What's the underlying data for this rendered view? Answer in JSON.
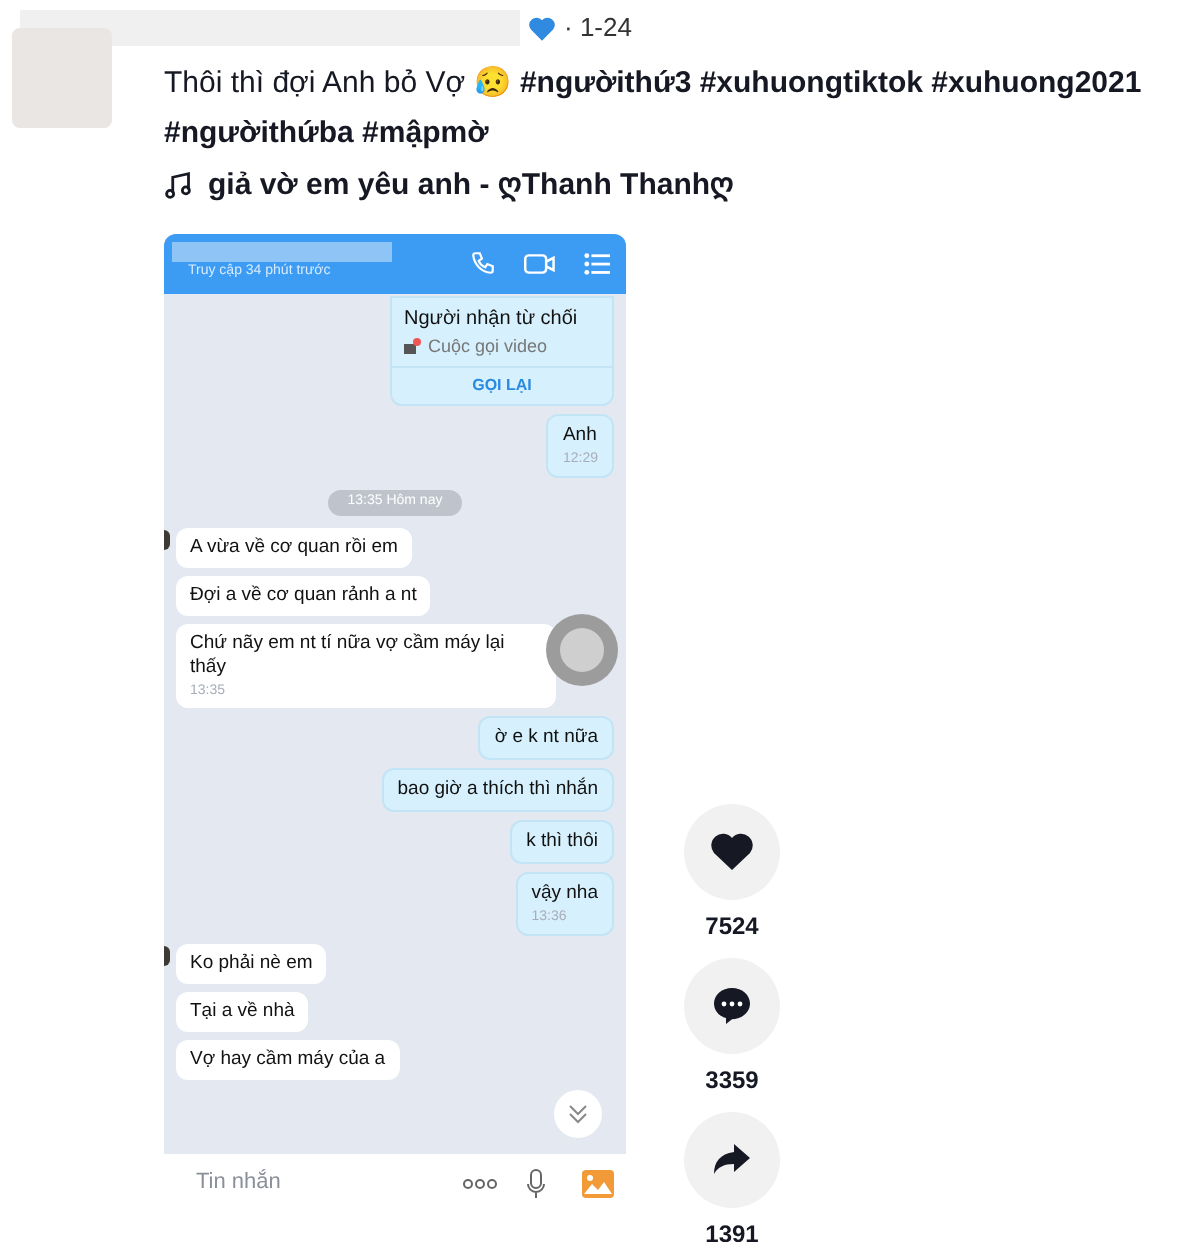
{
  "post": {
    "meta": "· 1-24",
    "caption": "Thôi thì đợi Anh bỏ Vợ 😥 **#ngườithứ3 #xuhuongtiktok #xuhuong2021 #ngườithứba #mậpmờ**",
    "sound": "giả vờ em yêu anh - ღThanh Thanhღ"
  },
  "chat": {
    "status": "Truy cập 34 phút trước",
    "call": {
      "title": "Người nhận từ chối",
      "subtitle": "Cuộc gọi video",
      "action": "GỌI LẠI"
    },
    "messages": [
      {
        "kind": "out",
        "text": "Anh",
        "time": "12:29"
      },
      {
        "kind": "divider",
        "text": "13:35 Hôm nay"
      },
      {
        "kind": "in",
        "text": "A vừa về cơ quan rồi em",
        "avatar": true
      },
      {
        "kind": "in",
        "text": "Đợi a về cơ quan rảnh a nt"
      },
      {
        "kind": "in",
        "text": "Chứ nãy em nt tí nữa vợ cầm máy lại thấy",
        "time": "13:35"
      },
      {
        "kind": "out",
        "text": "ờ e k nt nữa"
      },
      {
        "kind": "out",
        "text": "bao giờ a thích thì nhắn"
      },
      {
        "kind": "out",
        "text": "k thì thôi"
      },
      {
        "kind": "out",
        "text": "vậy nha",
        "time": "13:36"
      },
      {
        "kind": "in",
        "text": "Ko phải nè em",
        "avatar": true
      },
      {
        "kind": "in",
        "text": "Tại a về nhà"
      },
      {
        "kind": "in",
        "text": "Vợ hay cầm máy của a"
      }
    ],
    "input_placeholder": "Tin nhắn"
  },
  "actions": [
    {
      "kind": "like",
      "count": "7524"
    },
    {
      "kind": "comment",
      "count": "3359"
    },
    {
      "kind": "share",
      "count": "1391"
    }
  ]
}
